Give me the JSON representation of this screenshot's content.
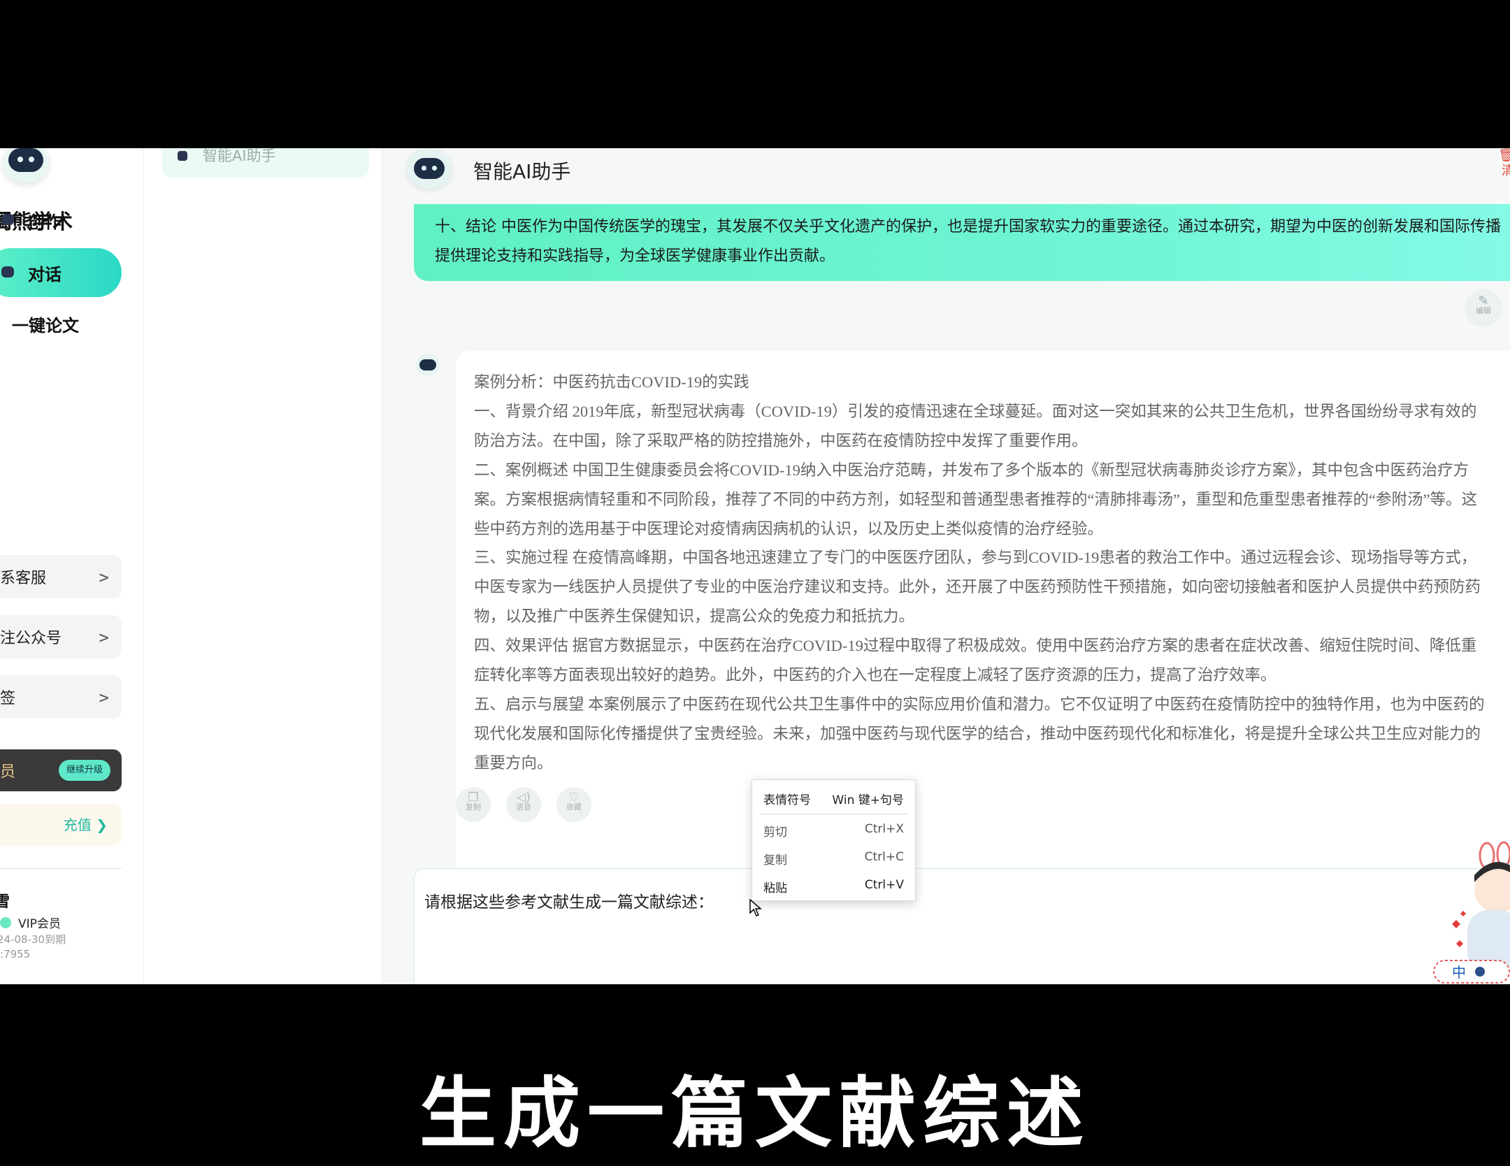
{
  "sidebar": {
    "brand": "阖熊学术",
    "nav": [
      {
        "label": "创作"
      },
      {
        "label": "对话"
      },
      {
        "label": "一键论文"
      }
    ],
    "links": [
      {
        "label": "系客服"
      },
      {
        "label": "注公众号"
      },
      {
        "label": "签"
      }
    ],
    "vip_label": "员",
    "upgrade_label": "继续升级",
    "recharge_label": "充值 ❯",
    "user": {
      "name": "雪",
      "level": "VIP会员",
      "expiry": "24-08-30到期",
      "id": ":7955"
    }
  },
  "history": {
    "items": [
      {
        "label": "智能AI助手"
      }
    ]
  },
  "chat": {
    "title": "智能AI助手",
    "clear_label": "清",
    "user_message": "十、结论 中医作为中国传统医学的瑰宝，其发展不仅关乎文化遗产的保护，也是提升国家软实力的重要途径。通过本研究，期望为中医的创新发展和国际传播提供理论支持和实践指导，为全球医学健康事业作出贡献。",
    "edit_label": "编辑",
    "bot_lines": [
      "案例分析：中医药抗击COVID-19的实践",
      "一、背景介绍 2019年底，新型冠状病毒（COVID-19）引发的疫情迅速在全球蔓延。面对这一突如其来的公共卫生危机，世界各国纷纷寻求有效的",
      "防治方法。在中国，除了采取严格的防控措施外，中医药在疫情防控中发挥了重要作用。",
      "二、案例概述 中国卫生健康委员会将COVID-19纳入中医治疗范畴，并发布了多个版本的《新型冠状病毒肺炎诊疗方案》，其中包含中医药治疗方",
      "案。方案根据病情轻重和不同阶段，推荐了不同的中药方剂，如轻型和普通型患者推荐的“清肺排毒汤”，重型和危重型患者推荐的“参附汤”等。这",
      "些中药方剂的选用基于中医理论对疫情病因病机的认识，以及历史上类似疫情的治疗经验。",
      "三、实施过程 在疫情高峰期，中国各地迅速建立了专门的中医医疗团队，参与到COVID-19患者的救治工作中。通过远程会诊、现场指导等方式，",
      "中医专家为一线医护人员提供了专业的中医治疗建议和支持。此外，还开展了中医药预防性干预措施，如向密切接触者和医护人员提供中药预防药",
      "物，以及推广中医养生保健知识，提高公众的免疫力和抵抗力。",
      "四、效果评估 据官方数据显示，中医药在治疗COVID-19过程中取得了积极成效。使用中医药治疗方案的患者在症状改善、缩短住院时间、降低重",
      "症转化率等方面表现出较好的趋势。此外，中医药的介入也在一定程度上减轻了医疗资源的压力，提高了治疗效率。",
      "五、启示与展望 本案例展示了中医药在现代公共卫生事件中的实际应用价值和潜力。它不仅证明了中医药在疫情防控中的独特作用，也为中医药的",
      "现代化发展和国际化传播提供了宝贵经验。未来，加强中医药与现代医学的结合，推动中医药现代化和标准化，将是提升全球公共卫生应对能力的",
      "重要方向。"
    ],
    "actions": {
      "copy": "复制",
      "voice": "语音",
      "favorite": "收藏"
    },
    "input_value": "请根据这些参考文献生成一篇文献综述："
  },
  "context_menu": {
    "emoji": {
      "label": "表情符号",
      "shortcut": "Win 键+句号"
    },
    "cut": {
      "label": "剪切",
      "shortcut": "Ctrl+X"
    },
    "copy": {
      "label": "复制",
      "shortcut": "Ctrl+C"
    },
    "paste": {
      "label": "粘贴",
      "shortcut": "Ctrl+V"
    }
  },
  "caption": "生成一篇文献综述",
  "colors": {
    "accent": "#3de3c4",
    "accent_light": "#6ff5d5",
    "danger": "#e04a3a",
    "vip_gold": "#e8c78a"
  }
}
